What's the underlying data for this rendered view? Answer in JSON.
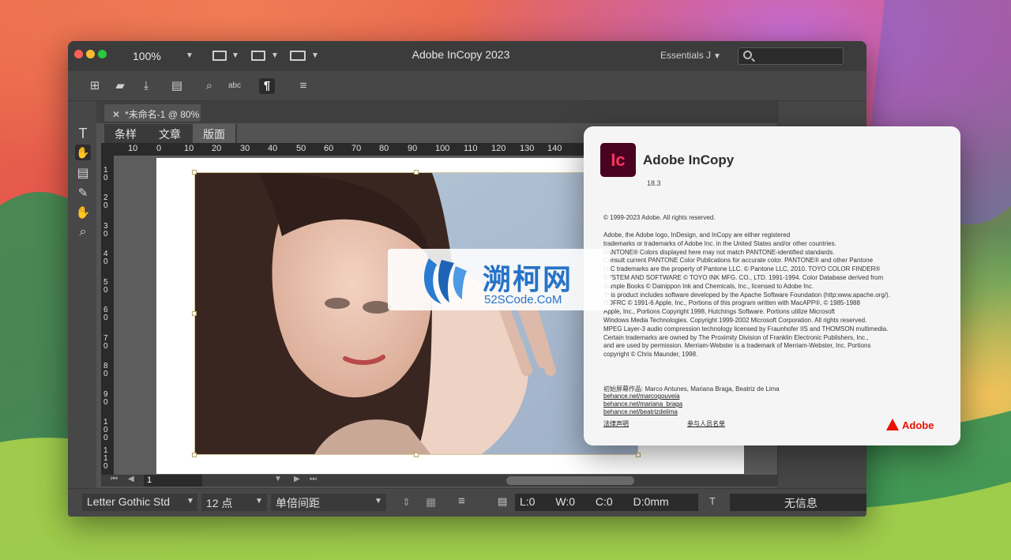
{
  "window": {
    "title": "Adobe InCopy 2023",
    "zoom": "100%",
    "workspace": "Essentials J",
    "search_placeholder": ""
  },
  "document_tab": {
    "label": "*未命名-1 @ 80%"
  },
  "view_tabs": [
    "条样",
    "文章",
    "版面"
  ],
  "ruler_h": [
    "10",
    "0",
    "10",
    "20",
    "30",
    "40",
    "50",
    "60",
    "70",
    "80",
    "90",
    "100",
    "110",
    "120",
    "130",
    "140"
  ],
  "ruler_v": [
    "10",
    "20",
    "30",
    "40",
    "50",
    "60",
    "70",
    "80",
    "90",
    "100",
    "110"
  ],
  "pager": {
    "current_page": "1"
  },
  "statusbar": {
    "font": "Letter Gothic Std",
    "size": "12 点",
    "leading": "单倍间距",
    "l": "L:0",
    "w": "W:0",
    "c": "C:0",
    "d": "D:0mm",
    "info": "无信息"
  },
  "about": {
    "product": "Adobe InCopy",
    "version": "18.3",
    "copyright": "© 1999-2023 Adobe. All rights reserved.",
    "legal": [
      "Adobe, the Adobe logo, InDesign, and InCopy are either registered",
      "trademarks or trademarks of Adobe Inc. in the United States and/or other countries.",
      "PANTONE® Colors displayed here may not match PANTONE-identified standards.",
      "Consult current PANTONE Color Publications for accurate color. PANTONE® and other Pantone",
      "LLC trademarks are the property of Pantone LLC. © Pantone LLC, 2010. TOYO COLOR FINDER®",
      "SYSTEM AND SOFTWARE © TOYO INK MFG. CO., LTD. 1991-1994. Color Database derived from",
      "Sample Books © Dainippon Ink and Chemicals, Inc., licensed to Adobe Inc.",
      "This product includes software developed by the Apache Software Foundation (http:www.apache.org/).",
      "ODFRC © 1991-6 Apple, Inc., Portions of this program written with MacAPP®, © 1985-1988",
      "Apple, Inc., Portions Copyright 1998, Hutchings Software. Portions utilize Microsoft",
      "Windows Media Technologies. Copyright 1999-2002 Microsoft Corporation. All rights reserved.",
      "MPEG Layer-3 audio compression technology licensed by Fraunhofer IIS and THOMSON multimedia.",
      "Certain trademarks are owned by The Proximity Division of Franklin Electronic Publishers, Inc.,",
      "and are used by permission. Merriam-Webster is a trademark of Merriam-Webster, Inc. Portions",
      "copyright © Chris Maunder, 1998."
    ],
    "credits": "初始屏幕作品: Marco Antunes, Mariana Braga, Beatriz de Lima",
    "credit_links": [
      "behance.net/marcogouveia",
      "behance.net/mariana_braga",
      "behance.net/beatrizdelima"
    ],
    "footer_links": [
      "法律声明",
      "参与人员名单"
    ],
    "brand": "Adobe"
  },
  "watermark": {
    "title": "溯柯网",
    "sub": "52SCode.CoM"
  },
  "colors": {
    "window_bg": "#535353",
    "titlebar": "#3c3c3c",
    "incopy_logo_bg": "#49021f",
    "incopy_logo_fg": "#ff3366",
    "adobe_red": "#eb1000",
    "watermark_blue": "#2673c9"
  }
}
